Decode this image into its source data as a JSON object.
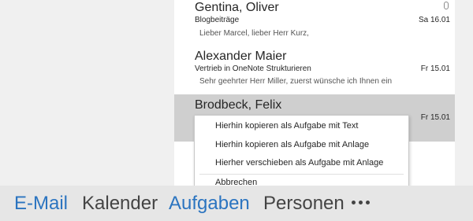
{
  "messages": [
    {
      "sender": "Gentina, Oliver",
      "subject": "Blogbeiträge",
      "date": "Sa 16.01",
      "preview": "Lieber Marcel, lieber Herr Kurz,",
      "attachment_icon": "paperclip-icon"
    },
    {
      "sender": "Alexander Maier",
      "subject": "Vertrieb in OneNote Strukturieren",
      "date": "Fr 15.01",
      "preview": "Sehr geehrter Herr Miller,  zuerst wünsche ich Ihnen ein"
    },
    {
      "sender": "Brodbeck, Felix",
      "subject": "",
      "date": "Fr 15.01"
    }
  ],
  "context_menu": {
    "items": [
      "Hierhin kopieren als Aufgabe mit Text",
      "Hierhin kopieren als Aufgabe mit Anlage",
      "Hierher verschieben als Aufgabe mit Anlage",
      "Abbrechen"
    ]
  },
  "bottom_nav": {
    "items": [
      "E-Mail",
      "Kalender",
      "Aufgaben",
      "Personen"
    ],
    "more_label": "more-options-icon"
  },
  "colors": {
    "accent": "#2b74c0",
    "selected_row": "#cfcfcf"
  }
}
